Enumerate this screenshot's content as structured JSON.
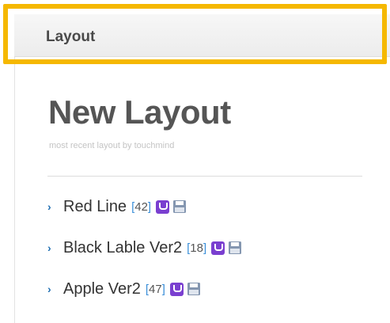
{
  "header": {
    "title": "Layout"
  },
  "main": {
    "title": "New Layout",
    "subtitle": "most recent layout by touchmind",
    "items": [
      {
        "name": "Red Line",
        "count": "42"
      },
      {
        "name": "Black Lable Ver2",
        "count": "18"
      },
      {
        "name": "Apple Ver2",
        "count": "47"
      }
    ]
  },
  "icons": {
    "chevron": "chevron-right-icon",
    "user": "u-icon",
    "save": "save-icon"
  },
  "colors": {
    "highlight": "#f5b800",
    "chevron": "#1f6fb2",
    "count_bracket": "#3b8fd9",
    "u_icon": "#7a3fd0",
    "save_icon": "#8496b0"
  }
}
